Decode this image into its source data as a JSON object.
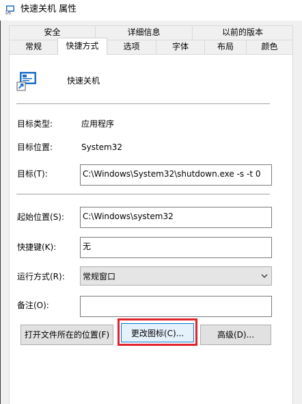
{
  "window": {
    "title": "快速关机 属性"
  },
  "tabs": {
    "row1": [
      {
        "label": "安全"
      },
      {
        "label": "详细信息"
      },
      {
        "label": "以前的版本"
      }
    ],
    "row2": [
      {
        "label": "常规"
      },
      {
        "label": "快捷方式",
        "active": true
      },
      {
        "label": "选项"
      },
      {
        "label": "字体"
      },
      {
        "label": "布局"
      },
      {
        "label": "颜色"
      }
    ]
  },
  "shortcut": {
    "name": "快速关机",
    "target_type_label": "目标类型:",
    "target_type_value": "应用程序",
    "target_location_label": "目标位置:",
    "target_location_value": "System32",
    "target_label": "目标(T):",
    "target_value": "C:\\Windows\\System32\\shutdown.exe -s -t 0",
    "start_in_label": "起始位置(S):",
    "start_in_value": "C:\\Windows\\system32",
    "hotkey_label": "快捷键(K):",
    "hotkey_value": "无",
    "run_label": "运行方式(R):",
    "run_value": "常规窗口",
    "comment_label": "备注(O):",
    "comment_value": ""
  },
  "buttons": {
    "open_location": "打开文件所在的位置(F)",
    "change_icon": "更改图标(C)...",
    "advanced": "高级(D)..."
  },
  "colors": {
    "highlight_border": "#e0222b",
    "focus_border": "#0078d7"
  },
  "icons": {
    "title": "shortcut-app-icon",
    "app": "shortcut-app-icon",
    "combo": "chevron-down-icon"
  }
}
